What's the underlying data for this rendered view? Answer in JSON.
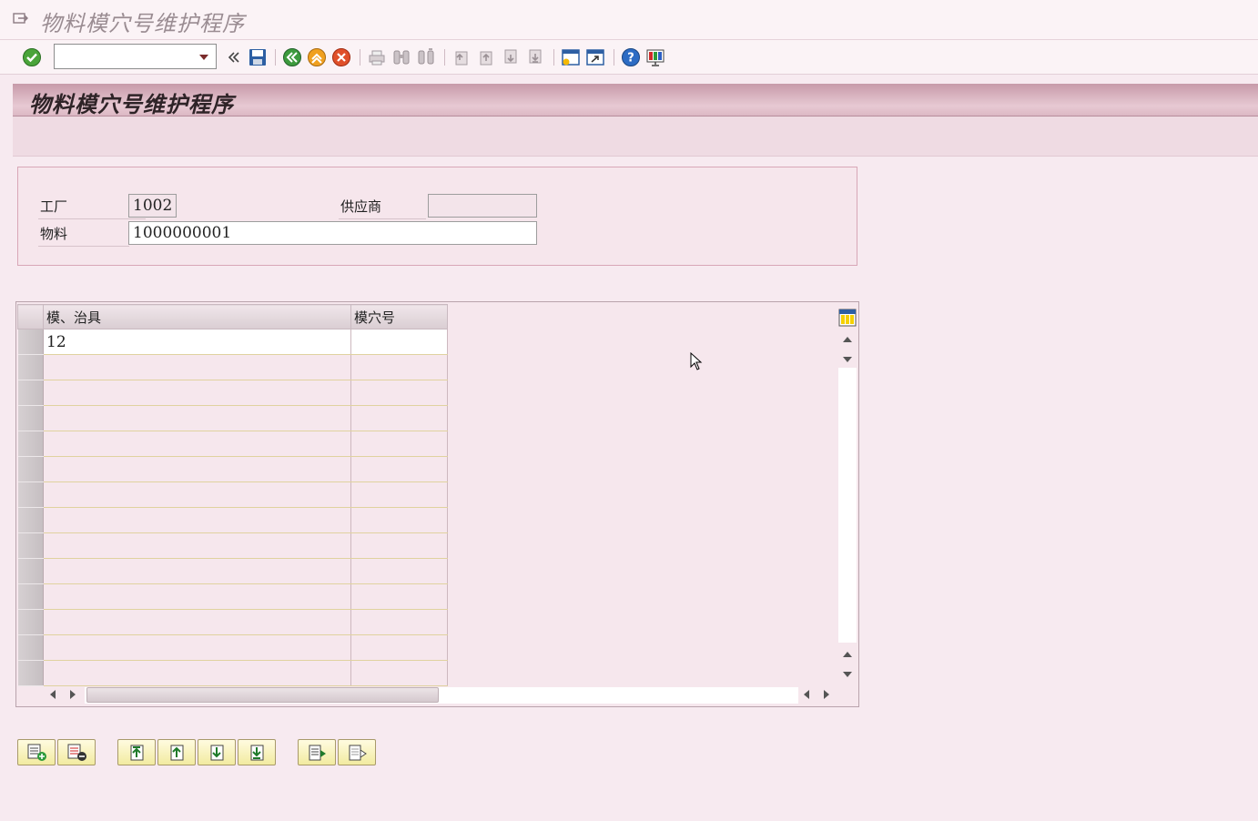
{
  "window": {
    "title": "物料模穴号维护程序"
  },
  "toolbar": {
    "command_value": "",
    "icons": [
      "enter-icon",
      "collapse-icon",
      "save-icon",
      "back-icon",
      "exit-icon",
      "cancel-icon",
      "print-icon",
      "find-icon",
      "find-next-icon",
      "first-page-icon",
      "previous-page-icon",
      "next-page-icon",
      "last-page-icon",
      "new-session-icon",
      "shortcut-icon",
      "help-icon",
      "layout-icon"
    ]
  },
  "program": {
    "title": "物料模穴号维护程序"
  },
  "header": {
    "plant_label": "工厂",
    "plant_value": "1002",
    "vendor_label": "供应商",
    "vendor_value": "",
    "material_label": "物料",
    "material_value": "1000000001"
  },
  "table": {
    "columns": [
      "模、治具",
      "模穴号"
    ],
    "rows": [
      [
        "12",
        ""
      ],
      [
        "",
        ""
      ],
      [
        "",
        ""
      ],
      [
        "",
        ""
      ],
      [
        "",
        ""
      ],
      [
        "",
        ""
      ],
      [
        "",
        ""
      ],
      [
        "",
        ""
      ],
      [
        "",
        ""
      ],
      [
        "",
        ""
      ],
      [
        "",
        ""
      ],
      [
        "",
        ""
      ],
      [
        "",
        ""
      ],
      [
        "",
        ""
      ]
    ]
  },
  "buttons": [
    "insert-row-icon",
    "delete-row-icon",
    "first-row-icon",
    "previous-row-icon",
    "next-row-icon",
    "last-row-icon",
    "select-all-icon",
    "deselect-all-icon"
  ]
}
